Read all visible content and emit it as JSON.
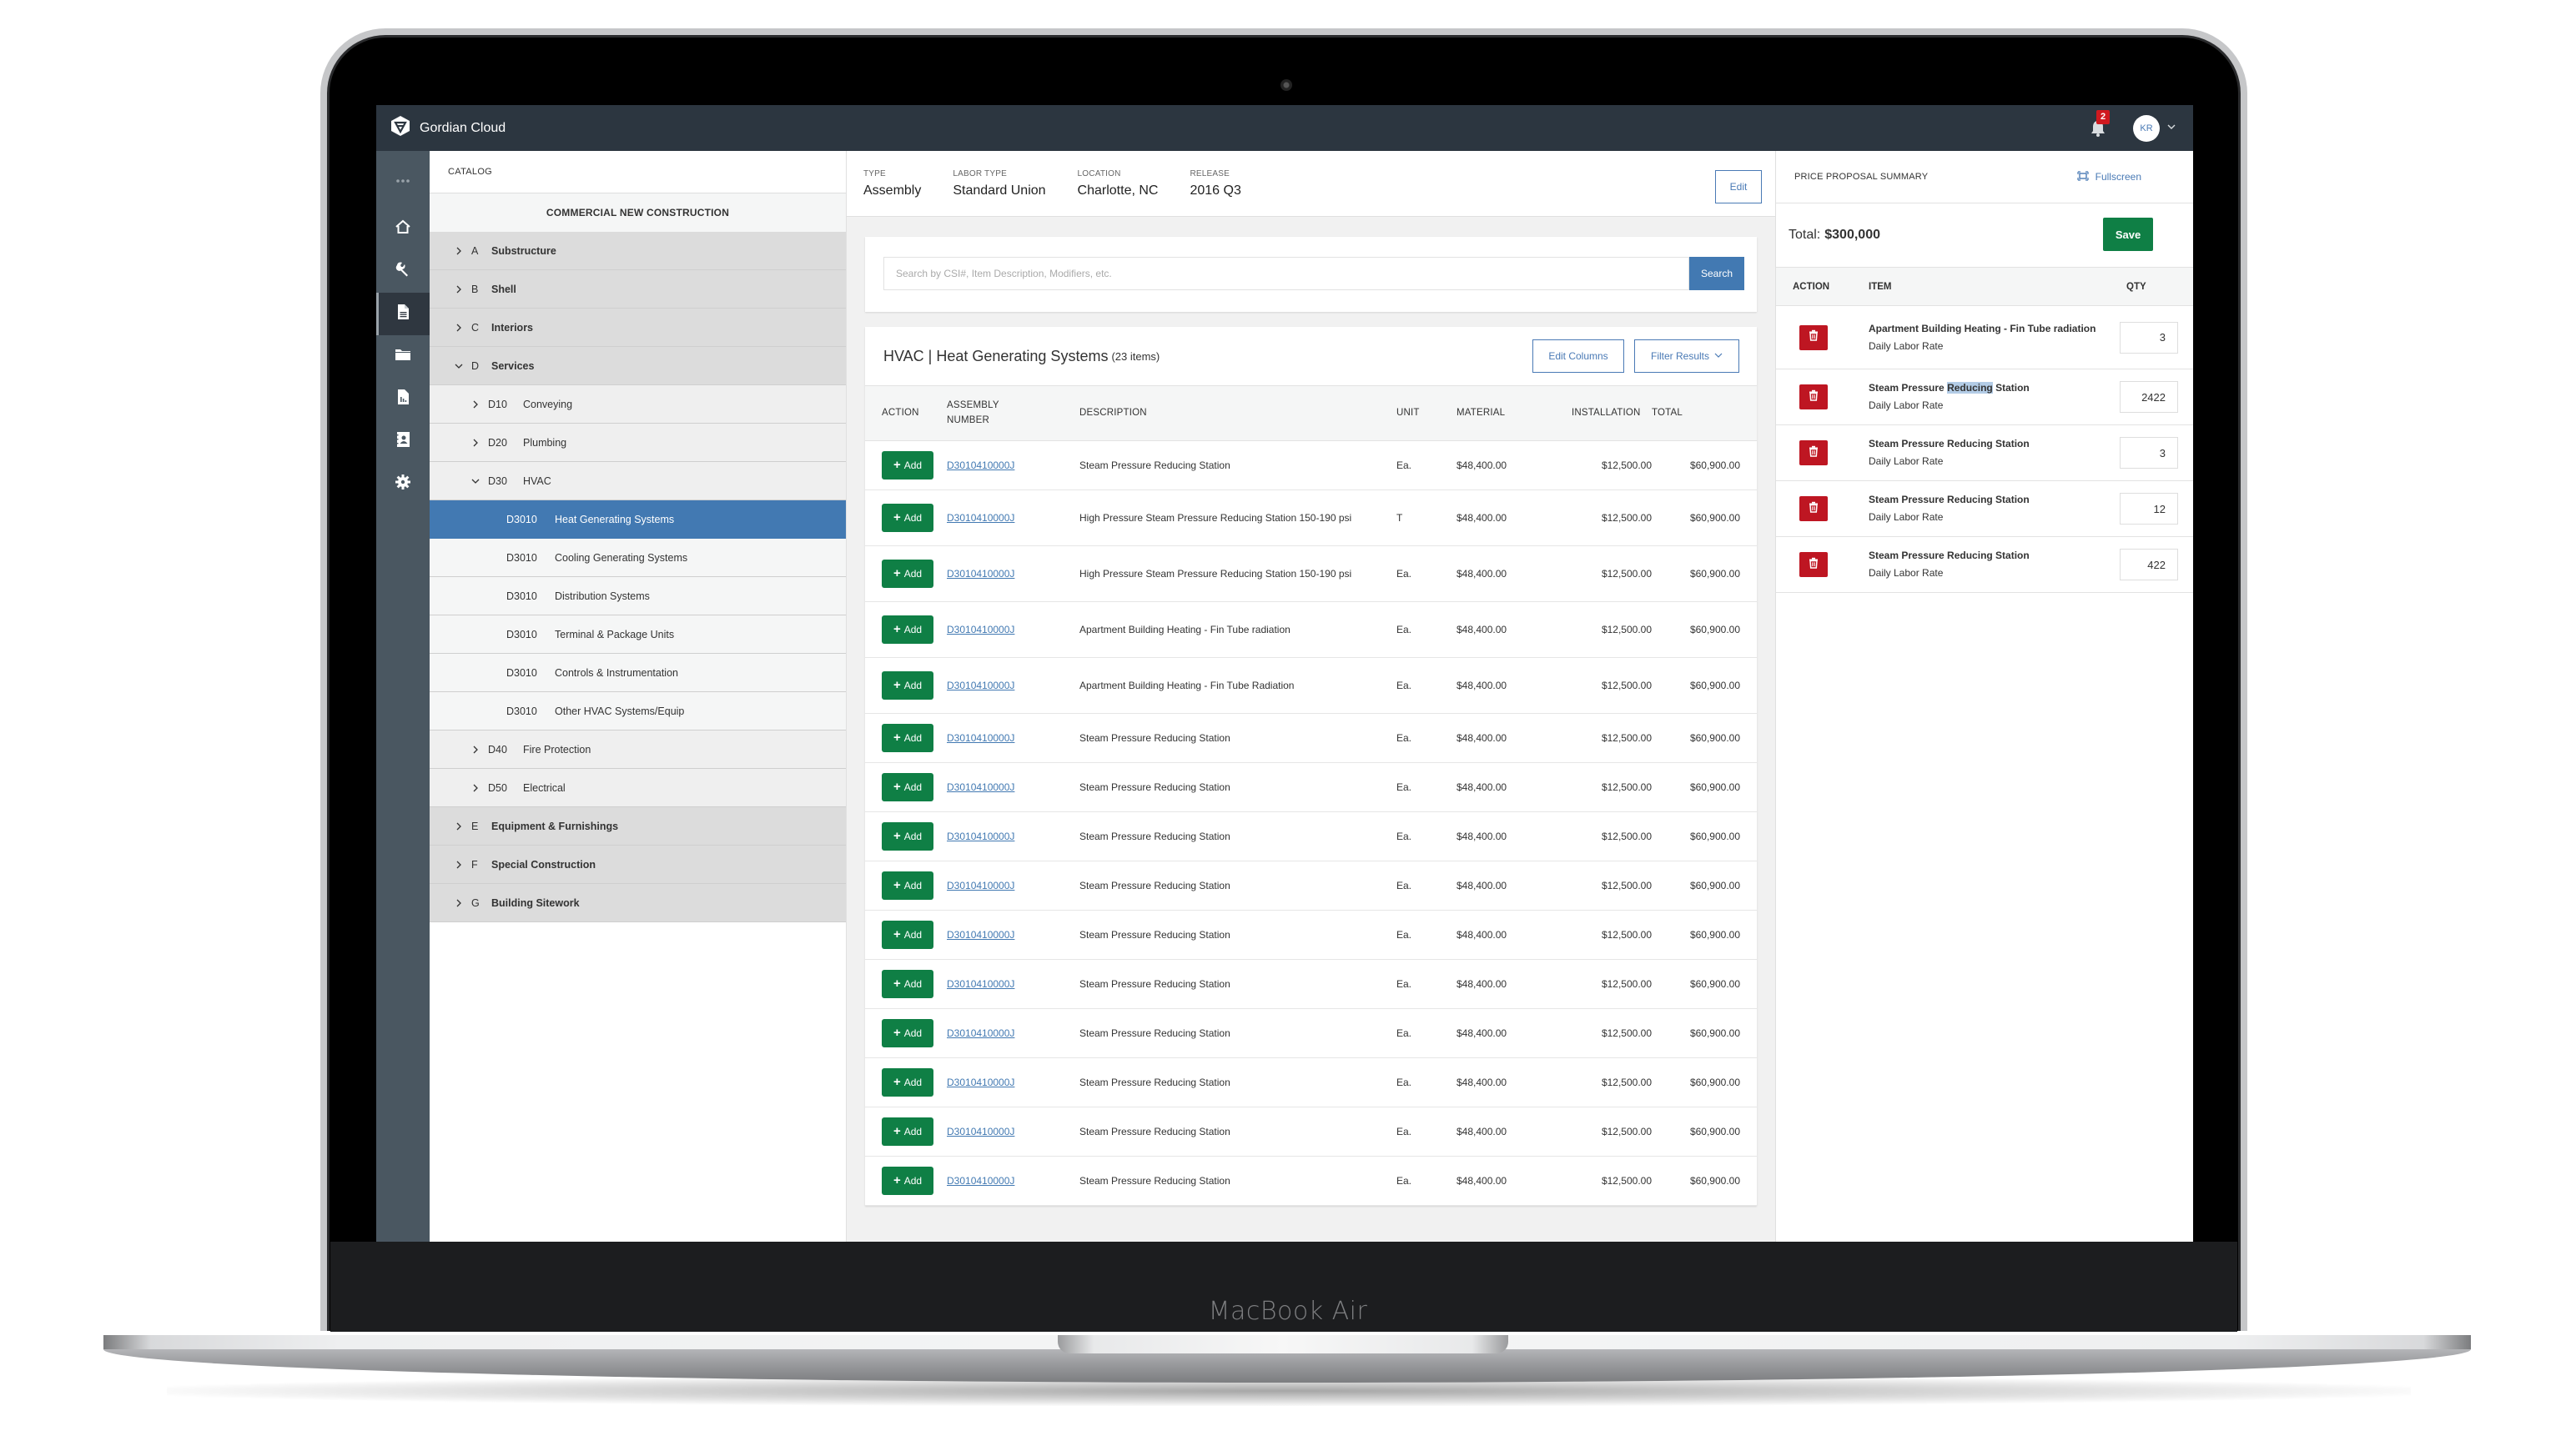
{
  "device": {
    "label": "MacBook Air"
  },
  "app": {
    "name": "Gordian Cloud",
    "notifications_count": "2",
    "user_initials": "KR"
  },
  "rail": {
    "items": [
      {
        "name": "more",
        "icon": "ellipsis-icon"
      },
      {
        "name": "home",
        "icon": "home-icon"
      },
      {
        "name": "tools",
        "icon": "wrench-icon"
      },
      {
        "name": "documents",
        "icon": "document-icon",
        "active": true
      },
      {
        "name": "folders",
        "icon": "folder-icon"
      },
      {
        "name": "reports",
        "icon": "report-icon"
      },
      {
        "name": "contacts",
        "icon": "contact-book-icon"
      },
      {
        "name": "settings",
        "icon": "gear-icon"
      }
    ]
  },
  "catalog": {
    "heading": "CATALOG",
    "subheading": "COMMERCIAL NEW CONSTRUCTION",
    "tree": [
      {
        "level": 1,
        "expanded": false,
        "code": "A",
        "label": "Substructure"
      },
      {
        "level": 1,
        "expanded": false,
        "code": "B",
        "label": "Shell"
      },
      {
        "level": 1,
        "expanded": false,
        "code": "C",
        "label": "Interiors"
      },
      {
        "level": 1,
        "expanded": true,
        "code": "D",
        "label": "Services"
      },
      {
        "level": 2,
        "expanded": false,
        "code": "D10",
        "label": "Conveying"
      },
      {
        "level": 2,
        "expanded": false,
        "code": "D20",
        "label": "Plumbing"
      },
      {
        "level": 2,
        "expanded": true,
        "code": "D30",
        "label": "HVAC"
      },
      {
        "level": 3,
        "code": "D3010",
        "label": "Heat Generating Systems",
        "selected": true
      },
      {
        "level": 3,
        "code": "D3010",
        "label": "Cooling Generating Systems"
      },
      {
        "level": 3,
        "code": "D3010",
        "label": "Distribution Systems"
      },
      {
        "level": 3,
        "code": "D3010",
        "label": "Terminal & Package Units"
      },
      {
        "level": 3,
        "code": "D3010",
        "label": "Controls & Instrumentation"
      },
      {
        "level": 3,
        "code": "D3010",
        "label": "Other HVAC Systems/Equip"
      },
      {
        "level": 2,
        "expanded": false,
        "code": "D40",
        "label": "Fire Protection"
      },
      {
        "level": 2,
        "expanded": false,
        "code": "D50",
        "label": "Electrical"
      },
      {
        "level": 1,
        "expanded": false,
        "code": "E",
        "label": "Equipment & Furnishings"
      },
      {
        "level": 1,
        "expanded": false,
        "code": "F",
        "label": "Special Construction"
      },
      {
        "level": 1,
        "expanded": false,
        "code": "G",
        "label": "Building Sitework"
      }
    ]
  },
  "meta": {
    "fields": [
      {
        "label": "TYPE",
        "value": "Assembly"
      },
      {
        "label": "LABOR TYPE",
        "value": "Standard Union"
      },
      {
        "label": "LOCATION",
        "value": "Charlotte, NC"
      },
      {
        "label": "RELEASE",
        "value": "2016 Q3"
      }
    ],
    "edit_label": "Edit"
  },
  "search": {
    "placeholder": "Search by CSI#, Item Description, Modifiers, etc.",
    "value": "",
    "button_label": "Search"
  },
  "results": {
    "title": "HVAC | Heat Generating Systems",
    "count_label": "(23 items)",
    "edit_columns_label": "Edit Columns",
    "filter_label": "Filter Results",
    "columns": [
      "ACTION",
      "ASSEMBLY NUMBER",
      "DESCRIPTION",
      "UNIT",
      "MATERIAL",
      "INSTALLATION",
      "TOTAL"
    ],
    "add_label": "Add",
    "rows": [
      {
        "number": "D3010410000J",
        "description": "Steam Pressure Reducing Station",
        "unit": "Ea.",
        "material": "$48,400.00",
        "installation": "$12,500.00",
        "total": "$60,900.00"
      },
      {
        "number": "D3010410000J",
        "description": "High Pressure Steam Pressure Reducing Station 150-190 psi",
        "unit": "T",
        "material": "$48,400.00",
        "installation": "$12,500.00",
        "total": "$60,900.00"
      },
      {
        "number": "D3010410000J",
        "description": "High Pressure Steam Pressure Reducing Station 150-190 psi",
        "unit": "Ea.",
        "material": "$48,400.00",
        "installation": "$12,500.00",
        "total": "$60,900.00"
      },
      {
        "number": "D3010410000J",
        "description": "Apartment Building Heating - Fin Tube radiation",
        "unit": "Ea.",
        "material": "$48,400.00",
        "installation": "$12,500.00",
        "total": "$60,900.00"
      },
      {
        "number": "D3010410000J",
        "description": "Apartment Building Heating - Fin Tube Radiation",
        "unit": "Ea.",
        "material": "$48,400.00",
        "installation": "$12,500.00",
        "total": "$60,900.00"
      },
      {
        "number": "D3010410000J",
        "description": "Steam Pressure Reducing Station",
        "unit": "Ea.",
        "material": "$48,400.00",
        "installation": "$12,500.00",
        "total": "$60,900.00"
      },
      {
        "number": "D3010410000J",
        "description": "Steam Pressure Reducing Station",
        "unit": "Ea.",
        "material": "$48,400.00",
        "installation": "$12,500.00",
        "total": "$60,900.00"
      },
      {
        "number": "D3010410000J",
        "description": "Steam Pressure Reducing Station",
        "unit": "Ea.",
        "material": "$48,400.00",
        "installation": "$12,500.00",
        "total": "$60,900.00"
      },
      {
        "number": "D3010410000J",
        "description": "Steam Pressure Reducing Station",
        "unit": "Ea.",
        "material": "$48,400.00",
        "installation": "$12,500.00",
        "total": "$60,900.00"
      },
      {
        "number": "D3010410000J",
        "description": "Steam Pressure Reducing Station",
        "unit": "Ea.",
        "material": "$48,400.00",
        "installation": "$12,500.00",
        "total": "$60,900.00"
      },
      {
        "number": "D3010410000J",
        "description": "Steam Pressure Reducing Station",
        "unit": "Ea.",
        "material": "$48,400.00",
        "installation": "$12,500.00",
        "total": "$60,900.00"
      },
      {
        "number": "D3010410000J",
        "description": "Steam Pressure Reducing Station",
        "unit": "Ea.",
        "material": "$48,400.00",
        "installation": "$12,500.00",
        "total": "$60,900.00"
      },
      {
        "number": "D3010410000J",
        "description": "Steam Pressure Reducing Station",
        "unit": "Ea.",
        "material": "$48,400.00",
        "installation": "$12,500.00",
        "total": "$60,900.00"
      },
      {
        "number": "D3010410000J",
        "description": "Steam Pressure Reducing Station",
        "unit": "Ea.",
        "material": "$48,400.00",
        "installation": "$12,500.00",
        "total": "$60,900.00"
      },
      {
        "number": "D3010410000J",
        "description": "Steam Pressure Reducing Station",
        "unit": "Ea.",
        "material": "$48,400.00",
        "installation": "$12,500.00",
        "total": "$60,900.00"
      }
    ]
  },
  "proposal": {
    "title": "PRICE PROPOSAL SUMMARY",
    "fullscreen_label": "Fullscreen",
    "total_label": "Total:",
    "total_value": "$300,000",
    "save_label": "Save",
    "columns": [
      "ACTION",
      "ITEM",
      "QTY"
    ],
    "items": [
      {
        "name": "Apartment Building Heating - Fin Tube radiation",
        "sub": "Daily Labor Rate",
        "qty": "3"
      },
      {
        "name": "Steam Pressure Reducing Station",
        "sub": "Daily Labor Rate",
        "qty": "2422",
        "highlight": "Reducing"
      },
      {
        "name": "Steam Pressure Reducing Station",
        "sub": "Daily Labor Rate",
        "qty": "3"
      },
      {
        "name": "Steam Pressure Reducing Station",
        "sub": "Daily Labor Rate",
        "qty": "12"
      },
      {
        "name": "Steam Pressure Reducing Station",
        "sub": "Daily Labor Rate",
        "qty": "422"
      }
    ]
  },
  "colors": {
    "topbar": "#2c3640",
    "rail": "#4a5761",
    "accent_blue": "#4279b2",
    "add_green": "#0f7f45",
    "delete_red": "#be1622",
    "badge_red": "#d0191f"
  }
}
